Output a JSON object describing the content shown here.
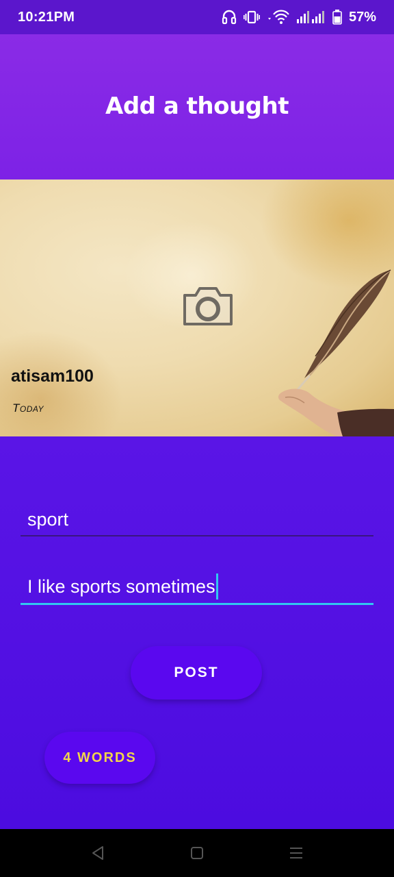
{
  "status_bar": {
    "time": "10:21",
    "ampm": "PM",
    "battery_percent": "57%"
  },
  "header": {
    "title": "Add a thought"
  },
  "cover": {
    "username": "atisam100",
    "date": "Today"
  },
  "form": {
    "title_value": "sport",
    "body_value": "I like sports sometimes",
    "post_label": "POST",
    "word_count_label": "4 WORDS"
  },
  "colors": {
    "header": "#8a2be6",
    "form_background": "#4c0ce0",
    "button": "#5a08ef",
    "word_count_text": "#f2d64a",
    "focus_underline": "#33c6f0"
  },
  "icons": {
    "status": [
      "headphones-icon",
      "vibrate-icon",
      "wifi-icon",
      "signal-icon",
      "battery-icon"
    ],
    "cover": "camera-icon",
    "nav": [
      "back-icon",
      "home-icon",
      "menu-icon"
    ]
  }
}
